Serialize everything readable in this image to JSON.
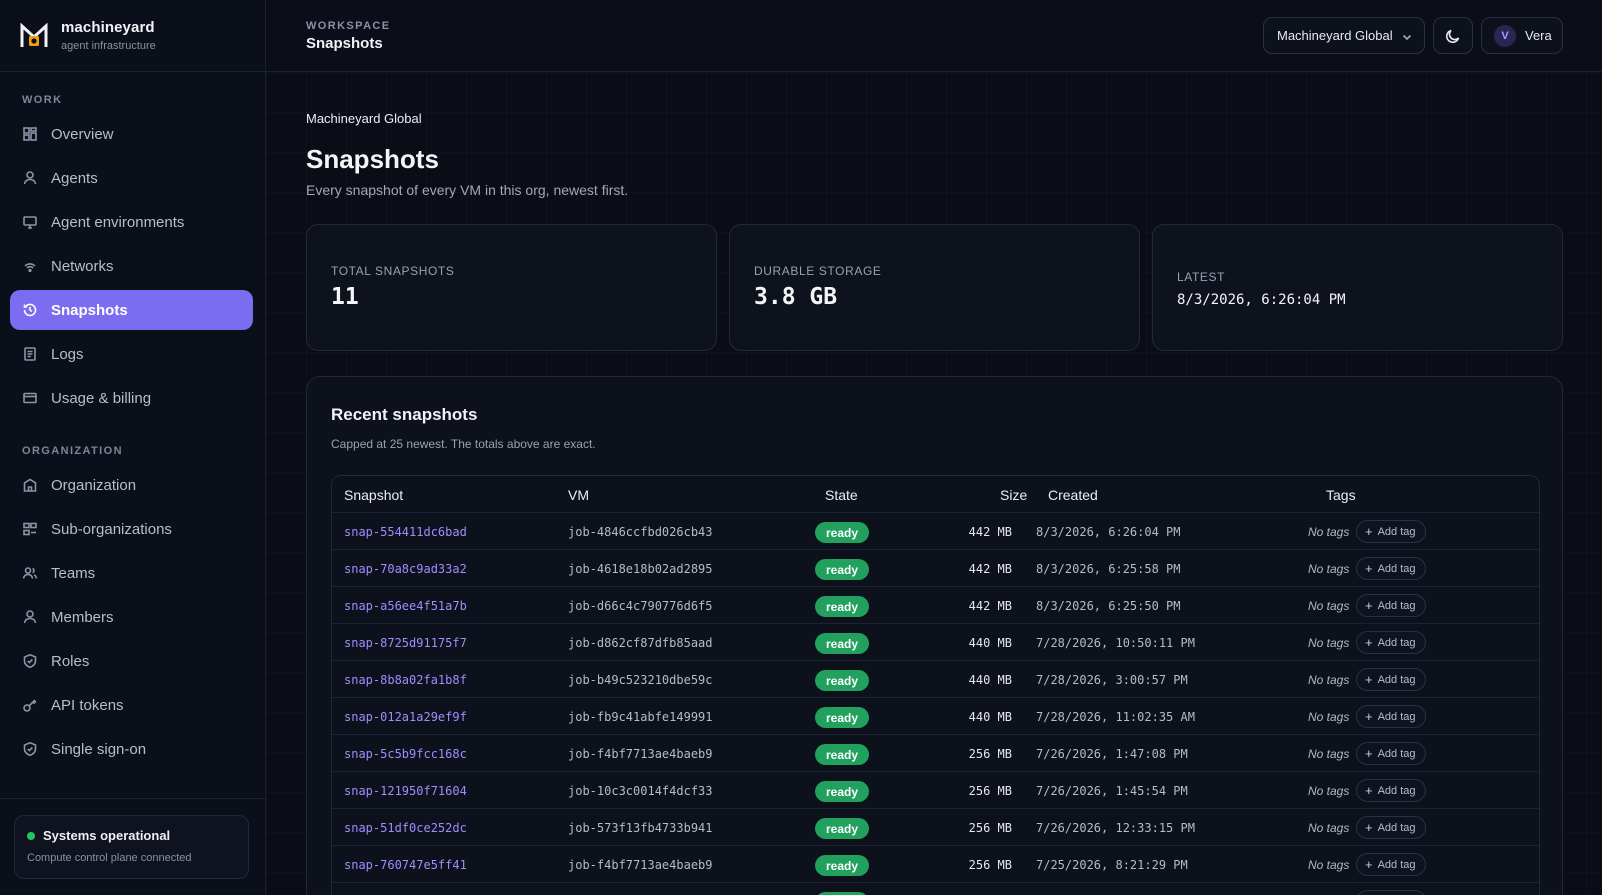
{
  "brand": {
    "name": "machineyard",
    "tagline": "agent infrastructure"
  },
  "sidebar": {
    "sections": [
      {
        "title": "WORK",
        "items": [
          {
            "label": "Overview",
            "icon": "grid-icon"
          },
          {
            "label": "Agents",
            "icon": "user-icon"
          },
          {
            "label": "Agent environments",
            "icon": "monitor-icon"
          },
          {
            "label": "Networks",
            "icon": "wifi-icon"
          },
          {
            "label": "Snapshots",
            "icon": "history-icon",
            "active": true
          },
          {
            "label": "Logs",
            "icon": "document-icon"
          },
          {
            "label": "Usage & billing",
            "icon": "card-icon"
          }
        ]
      },
      {
        "title": "ORGANIZATION",
        "items": [
          {
            "label": "Organization",
            "icon": "building-icon"
          },
          {
            "label": "Sub-organizations",
            "icon": "blocks-icon"
          },
          {
            "label": "Teams",
            "icon": "users-icon"
          },
          {
            "label": "Members",
            "icon": "member-icon"
          },
          {
            "label": "Roles",
            "icon": "shield-icon"
          },
          {
            "label": "API tokens",
            "icon": "key-icon"
          },
          {
            "label": "Single sign-on",
            "icon": "shield-check-icon"
          }
        ]
      }
    ],
    "status": {
      "title": "Systems operational",
      "subtitle": "Compute control plane connected",
      "color": "#22c55e"
    }
  },
  "topbar": {
    "section_label": "WORKSPACE",
    "page_label": "Snapshots",
    "org_selector": "Machineyard Global",
    "user": {
      "initial": "V",
      "name": "Vera"
    }
  },
  "page": {
    "org": "Machineyard Global",
    "title": "Snapshots",
    "subtitle": "Every snapshot of every VM in this org, newest first."
  },
  "stats": {
    "total_label": "TOTAL SNAPSHOTS",
    "total_value": "11",
    "storage_label": "DURABLE STORAGE",
    "storage_value": "3.8 GB",
    "latest_label": "LATEST",
    "latest_value": "8/3/2026, 6:26:04 PM"
  },
  "recent": {
    "title": "Recent snapshots",
    "subtitle": "Capped at 25 newest. The totals above are exact.",
    "columns": [
      "Snapshot",
      "VM",
      "State",
      "Size",
      "Created",
      "Tags"
    ],
    "no_tags_label": "No tags",
    "add_tag_label": "Add tag",
    "rows": [
      {
        "snapshot": "snap-554411dc6bad",
        "vm": "job-4846ccfbd026cb43",
        "state": "ready",
        "size": "442 MB",
        "created": "8/3/2026, 6:26:04 PM"
      },
      {
        "snapshot": "snap-70a8c9ad33a2",
        "vm": "job-4618e18b02ad2895",
        "state": "ready",
        "size": "442 MB",
        "created": "8/3/2026, 6:25:58 PM"
      },
      {
        "snapshot": "snap-a56ee4f51a7b",
        "vm": "job-d66c4c790776d6f5",
        "state": "ready",
        "size": "442 MB",
        "created": "8/3/2026, 6:25:50 PM"
      },
      {
        "snapshot": "snap-8725d91175f7",
        "vm": "job-d862cf87dfb85aad",
        "state": "ready",
        "size": "440 MB",
        "created": "7/28/2026, 10:50:11 PM"
      },
      {
        "snapshot": "snap-8b8a02fa1b8f",
        "vm": "job-b49c523210dbe59c",
        "state": "ready",
        "size": "440 MB",
        "created": "7/28/2026, 3:00:57 PM"
      },
      {
        "snapshot": "snap-012a1a29ef9f",
        "vm": "job-fb9c41abfe149991",
        "state": "ready",
        "size": "440 MB",
        "created": "7/28/2026, 11:02:35 AM"
      },
      {
        "snapshot": "snap-5c5b9fcc168c",
        "vm": "job-f4bf7713ae4baeb9",
        "state": "ready",
        "size": "256 MB",
        "created": "7/26/2026, 1:47:08 PM"
      },
      {
        "snapshot": "snap-121950f71604",
        "vm": "job-10c3c0014f4dcf33",
        "state": "ready",
        "size": "256 MB",
        "created": "7/26/2026, 1:45:54 PM"
      },
      {
        "snapshot": "snap-51df0ce252dc",
        "vm": "job-573f13fb4733b941",
        "state": "ready",
        "size": "256 MB",
        "created": "7/26/2026, 12:33:15 PM"
      },
      {
        "snapshot": "snap-760747e5ff41",
        "vm": "job-f4bf7713ae4baeb9",
        "state": "ready",
        "size": "256 MB",
        "created": "7/25/2026, 8:21:29 PM"
      },
      {
        "snapshot": "",
        "vm": "",
        "state": "ready",
        "size": "",
        "created": ""
      }
    ]
  },
  "colors": {
    "accent": "#7c6cf0",
    "link": "#a08cff",
    "ready": "#22a05d",
    "background": "#0a0d16"
  }
}
